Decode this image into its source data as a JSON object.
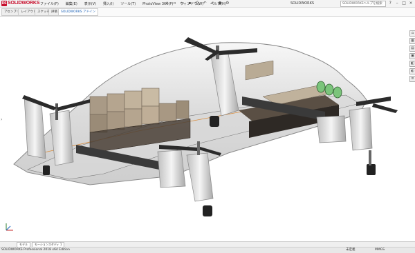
{
  "app": {
    "logo_text": "SOLIDWORKS",
    "logo_mark": "DS"
  },
  "menus": [
    "ファイル(F)",
    "編集(E)",
    "表示(V)",
    "挿入(I)",
    "ツール(T)",
    "PhotoView 360(P)",
    "ウィンドウ(W)",
    "ヘルプ(H)"
  ],
  "quick_access": [
    "home-icon",
    "new-icon",
    "open-icon",
    "save-icon",
    "print-icon",
    "undo-icon",
    "select-icon",
    "rebuild-icon",
    "options-icon"
  ],
  "document_title": "SOLIDWORKS",
  "search": {
    "placeholder": "SOLIDWORKSヘルプを検索"
  },
  "window_controls": [
    "?",
    "–",
    "□",
    "×"
  ],
  "command_tabs": [
    "アセンブリ",
    "レイアウト",
    "スケッチ",
    "評価",
    "SOLIDWORKS アドイン"
  ],
  "active_tab_index": 4,
  "bottom_tabs": [
    "モデル",
    "モーションスタディ 1"
  ],
  "status": {
    "left": "SOLIDWORKS Professional 2018 x64 Edition",
    "right1": "未定義",
    "right2": "MMGS"
  },
  "task_pane_icons": [
    "home-icon",
    "resources-icon",
    "library-icon",
    "file-explorer-icon",
    "view-palette-icon",
    "appearance-icon",
    "custom-properties-icon"
  ],
  "colors": {
    "brand": "#c8102e",
    "accent": "#1a5fb4"
  }
}
